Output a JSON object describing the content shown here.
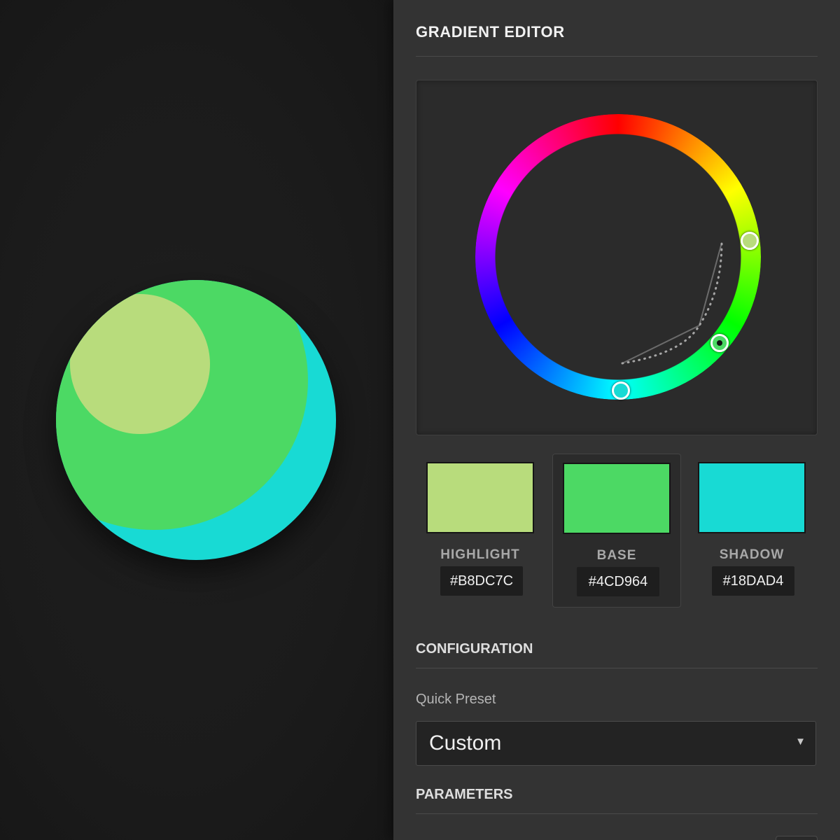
{
  "panel": {
    "title": "GRADIENT EDITOR"
  },
  "colors": {
    "highlight": "#B8DC7C",
    "base": "#4CD964",
    "shadow": "#18DAD4"
  },
  "swatches": [
    {
      "label": "HIGHLIGHT",
      "hex": "#B8DC7C",
      "selected": false
    },
    {
      "label": "BASE",
      "hex": "#4CD964",
      "selected": true
    },
    {
      "label": "SHADOW",
      "hex": "#18DAD4",
      "selected": false
    }
  ],
  "configuration": {
    "title": "CONFIGURATION",
    "quick_preset_label": "Quick Preset",
    "quick_preset_value": "Custom",
    "dropdown_arrow": "▼"
  },
  "parameters": {
    "title": "PARAMETERS"
  },
  "icons": {
    "dropdown": "chevron-down-icon"
  }
}
